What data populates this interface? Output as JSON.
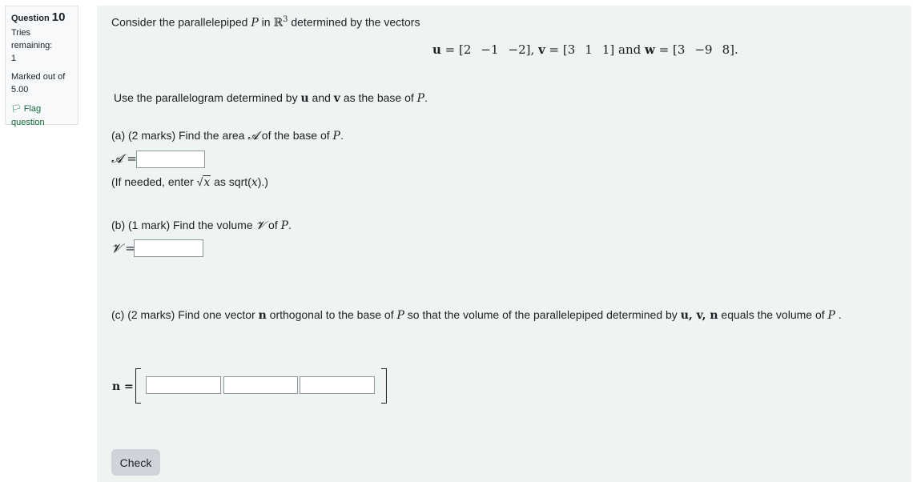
{
  "info": {
    "question_prefix": "Question",
    "question_number": "10",
    "tries_label": "Tries remaining:",
    "tries_value": "1",
    "marked_label": "Marked out of",
    "marked_value": "5.00",
    "flag_label": "Flag question",
    "flag_icon": "flag-icon"
  },
  "intro": {
    "t1": "Consider the parallelepiped ",
    "P": "P",
    "t2": " in ",
    "R": "ℝ",
    "sup": "3",
    "t3": " determined  by the vectors"
  },
  "vectors": {
    "u_name": "u",
    "u_vals": [
      "2",
      "−1",
      "−2"
    ],
    "v_name": "v",
    "v_vals": [
      "3",
      "1",
      "1"
    ],
    "and_word": "and",
    "w_name": "w",
    "w_vals": [
      "3",
      "−9",
      "8"
    ]
  },
  "base_text": {
    "t1": "Use the parallelogram determined by ",
    "u": "u",
    "t2": " and ",
    "v": "v",
    "t3": " as the base of ",
    "P": "P",
    "t4": "."
  },
  "part_a": {
    "t1": "(a) (2 marks)   Find the area ",
    "A": "𝓐",
    "t2": " of the base of ",
    "P": "P",
    "t3": ".",
    "label": "𝓐 =",
    "value": "",
    "hint_t1": "(If needed, enter ",
    "hint_x": "x",
    "hint_t2": " as sqrt(",
    "hint_x2": "x",
    "hint_t3": ").)"
  },
  "part_b": {
    "t1": "(b) (1 mark) Find the volume ",
    "V": "𝓥",
    "t2": " of ",
    "P": "P",
    "t3": ".",
    "label": "𝓥 =",
    "value": ""
  },
  "part_c": {
    "t1": "(c) (2 marks) Find one vector ",
    "n": "n",
    "t2": " orthogonal to the base of ",
    "P": "P",
    "t3": " so that the volume of the parallelepiped determined by ",
    "uvn": "u, v, n",
    "t4": " equals the volume of ",
    "P2": "P",
    "t5": " .",
    "label": "n =",
    "values": [
      "",
      "",
      ""
    ]
  },
  "check_label": "Check"
}
